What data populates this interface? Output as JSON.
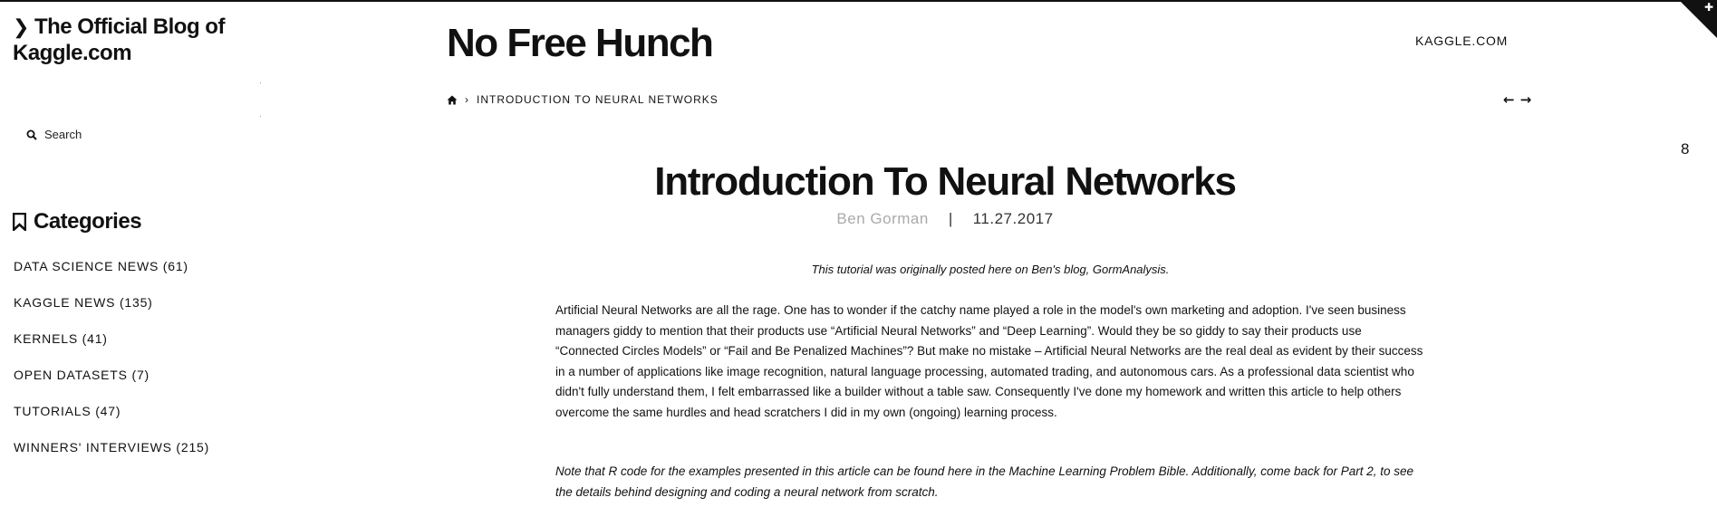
{
  "sidebar": {
    "blog_title": "The Official Blog of Kaggle.com",
    "search_label": "Search",
    "categories_heading": "Categories",
    "categories": [
      {
        "label": "DATA SCIENCE NEWS (61)"
      },
      {
        "label": "KAGGLE NEWS (135)"
      },
      {
        "label": "KERNELS (41)"
      },
      {
        "label": "OPEN DATASETS (7)"
      },
      {
        "label": "TUTORIALS (47)"
      },
      {
        "label": "WINNERS' INTERVIEWS (215)"
      }
    ]
  },
  "header": {
    "site_name": "No Free Hunch",
    "external_link": "KAGGLE.COM",
    "breadcrumb_current": "INTRODUCTION TO NEURAL NETWORKS",
    "prev_arrow": "←",
    "next_arrow": "→",
    "side_number": "8"
  },
  "post": {
    "title": "Introduction To Neural Networks",
    "author": "Ben Gorman",
    "meta_separator": "|",
    "date": "11.27.2017",
    "intro_note": "This tutorial was originally posted here on Ben's blog, GormAnalysis.",
    "paragraph_1": "Artificial Neural Networks are all the rage. One has to wonder if the catchy name played a role in the model's own marketing and adoption. I've seen business managers giddy to mention that their products use “Artificial Neural Networks” and “Deep Learning”. Would they be so giddy to say their products use “Connected Circles Models” or “Fail and Be Penalized Machines”? But make no mistake – Artificial Neural Networks are the real deal as evident by their success in a number of applications like image recognition, natural language processing, automated trading, and autonomous cars. As a professional data scientist who didn't fully understand them, I felt embarrassed like a builder without a table saw. Consequently I've done my homework and written this article to help others overcome the same hurdles and head scratchers I did in my own (ongoing) learning process.",
    "paragraph_2": "Note that R code for the examples presented in this article can be found here in the Machine Learning Problem Bible. Additionally, come back for Part 2, to see the details behind designing and coding a neural network from scratch."
  },
  "colors": {
    "text": "#111111",
    "author_muted": "#aaaaaa",
    "background": "#ffffff"
  }
}
